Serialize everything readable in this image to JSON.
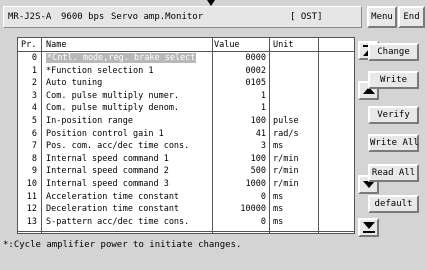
{
  "title_bar": {
    "model": "MR-J2S-A",
    "baud": "9600 bps",
    "window_name": "Servo amp.Monitor",
    "status": "[ OST]"
  },
  "top_buttons": {
    "menu": "Menu",
    "end": "End"
  },
  "table": {
    "headers": {
      "pr": "Pr.",
      "name": "Name",
      "value": "Value",
      "unit": "Unit"
    },
    "rows": [
      {
        "pr": "0",
        "name": "*Cntl. mode,reg. brake select",
        "value": "0000",
        "unit": ""
      },
      {
        "pr": "1",
        "name": "*Function selection 1",
        "value": "0002",
        "unit": ""
      },
      {
        "pr": "2",
        "name": "Auto tuning",
        "value": "0105",
        "unit": ""
      },
      {
        "pr": "3",
        "name": "Com. pulse multiply numer.",
        "value": "1",
        "unit": ""
      },
      {
        "pr": "4",
        "name": "Com. pulse multiply denom.",
        "value": "1",
        "unit": ""
      },
      {
        "pr": "5",
        "name": "In-position range",
        "value": "100",
        "unit": "pulse"
      },
      {
        "pr": "6",
        "name": "Position control gain 1",
        "value": "41",
        "unit": "rad/s"
      },
      {
        "pr": "7",
        "name": "Pos. com. acc/dec time cons.",
        "value": "3",
        "unit": "ms"
      },
      {
        "pr": "8",
        "name": "Internal speed command 1",
        "value": "100",
        "unit": "r/min"
      },
      {
        "pr": "9",
        "name": "Internal speed command 2",
        "value": "500",
        "unit": "r/min"
      },
      {
        "pr": "10",
        "name": "Internal speed command 3",
        "value": "1000",
        "unit": "r/min"
      },
      {
        "pr": "11",
        "name": "Acceleration time constant",
        "value": "0",
        "unit": "ms"
      },
      {
        "pr": "12",
        "name": "Deceleration time constant",
        "value": "10000",
        "unit": "ms"
      },
      {
        "pr": "13",
        "name": "S-pattern acc/dec time cons.",
        "value": "0",
        "unit": "ms"
      }
    ],
    "selected_row": 0
  },
  "side_buttons": {
    "change": "Change",
    "write": "Write",
    "verify": "Verify",
    "write_all": "Write All",
    "read_all": "Read All",
    "default": "default"
  },
  "footer": "*:Cycle amplifier power to initiate changes."
}
